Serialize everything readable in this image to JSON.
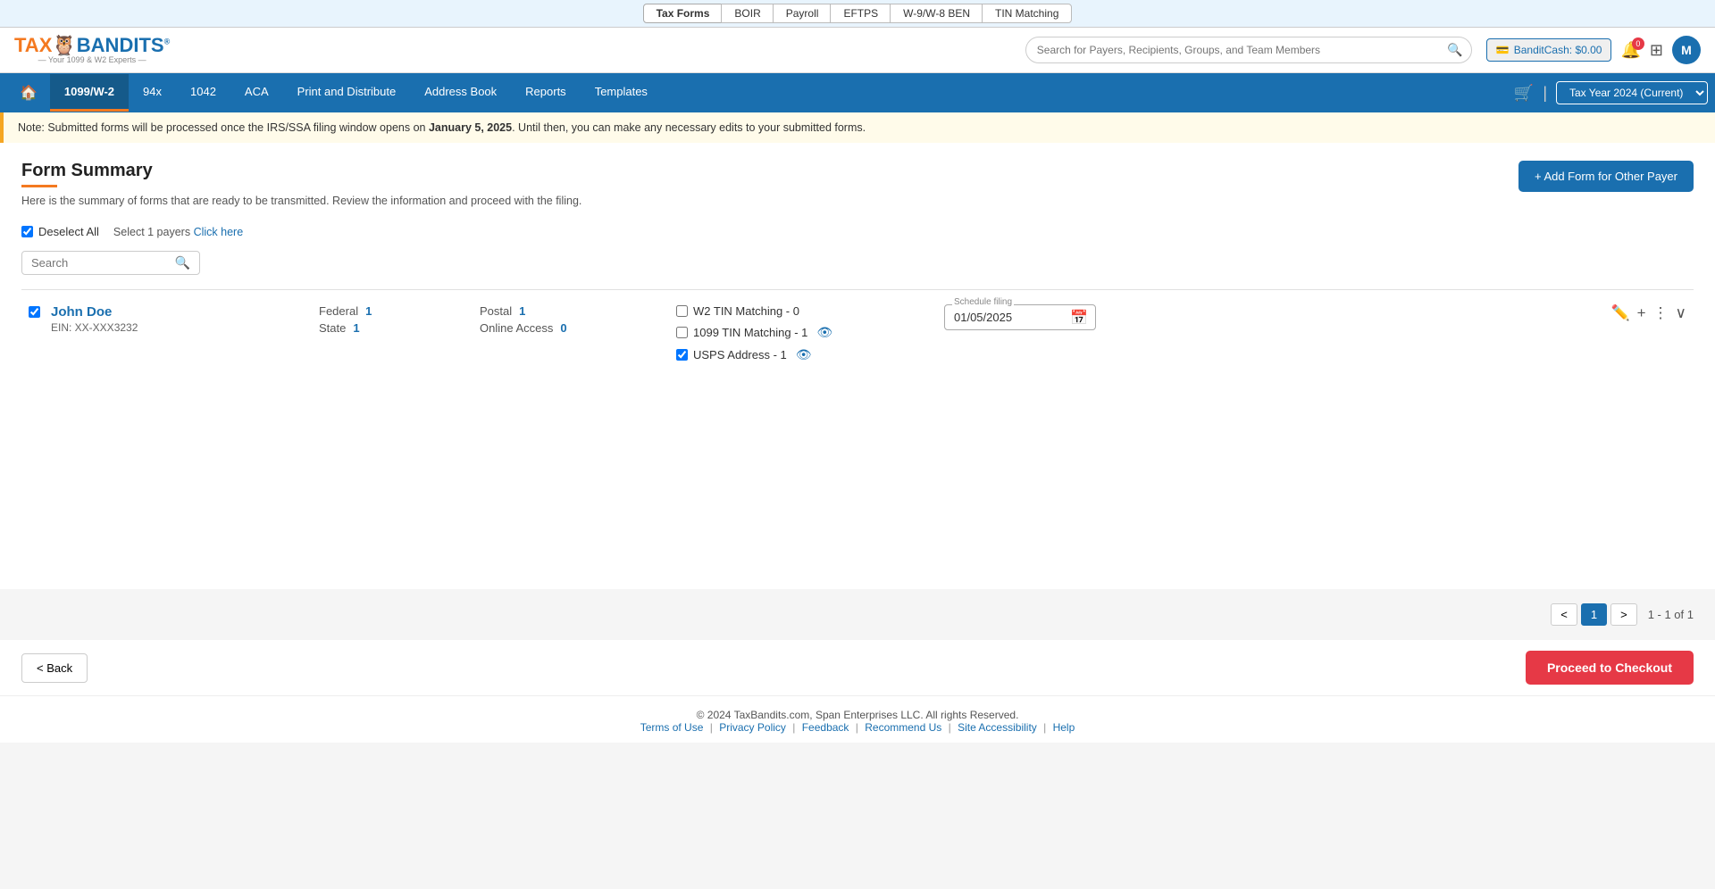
{
  "topNav": {
    "items": [
      {
        "label": "Tax Forms",
        "active": true
      },
      {
        "label": "BOIR",
        "active": false
      },
      {
        "label": "Payroll",
        "active": false
      },
      {
        "label": "EFTPS",
        "active": false
      },
      {
        "label": "W-9/W-8 BEN",
        "active": false
      },
      {
        "label": "TIN Matching",
        "active": false
      }
    ]
  },
  "header": {
    "logo": {
      "main": "TAXBANDITS",
      "sub": "— Your 1099 & W2 Experts —"
    },
    "search": {
      "placeholder": "Search for Payers, Recipients, Groups, and Team Members"
    },
    "banditCash": {
      "label": "BanditCash: $0.00"
    },
    "notificationCount": "0",
    "avatar": "M"
  },
  "mainNav": {
    "items": [
      {
        "label": "1099/W-2",
        "active": true
      },
      {
        "label": "94x",
        "active": false
      },
      {
        "label": "1042",
        "active": false
      },
      {
        "label": "ACA",
        "active": false
      },
      {
        "label": "Print and Distribute",
        "active": false
      },
      {
        "label": "Address Book",
        "active": false
      },
      {
        "label": "Reports",
        "active": false
      },
      {
        "label": "Templates",
        "active": false
      }
    ],
    "yearSelector": "Tax Year 2024 (Current)"
  },
  "noteBanner": {
    "text": "Note: Submitted forms will be processed once the IRS/SSA filing window opens on ",
    "boldDate": "January 5, 2025",
    "textAfter": ". Until then, you can make any necessary edits to your submitted forms."
  },
  "page": {
    "title": "Form Summary",
    "description": "Here is the summary of forms that are ready to be transmitted. Review the information and proceed with the filing.",
    "addFormBtn": "+ Add Form for Other Payer",
    "deselectAll": "Deselect All",
    "selectPayers": "Select 1 payers",
    "clickHere": "Click here",
    "searchPlaceholder": "Search"
  },
  "payer": {
    "name": "John Doe",
    "ein": "EIN: XX-XXX3232",
    "federal": {
      "label": "Federal",
      "value": "1"
    },
    "state": {
      "label": "State",
      "value": "1"
    },
    "postal": {
      "label": "Postal",
      "value": "1"
    },
    "onlineAccess": {
      "label": "Online Access",
      "value": "0"
    },
    "w2TinMatching": "W2 TIN Matching - 0",
    "w2TinChecked": false,
    "tin1099Matching": "1099 TIN Matching - 1",
    "tin1099Checked": false,
    "uspsAddress": "USPS Address - 1",
    "uspsChecked": true,
    "scheduleFiling": {
      "label": "Schedule filing",
      "value": "01/05/2025"
    }
  },
  "pagination": {
    "currentPage": 1,
    "totalPages": 1,
    "info": "1 - 1 of 1"
  },
  "actions": {
    "backBtn": "< Back",
    "checkoutBtn": "Proceed to Checkout"
  },
  "footer": {
    "copyright": "© 2024 TaxBandits.com, Span Enterprises LLC. All rights Reserved.",
    "links": [
      {
        "label": "Terms of Use"
      },
      {
        "label": "Privacy Policy"
      },
      {
        "label": "Feedback"
      },
      {
        "label": "Recommend Us"
      },
      {
        "label": "Site Accessibility"
      },
      {
        "label": "Help"
      }
    ]
  }
}
